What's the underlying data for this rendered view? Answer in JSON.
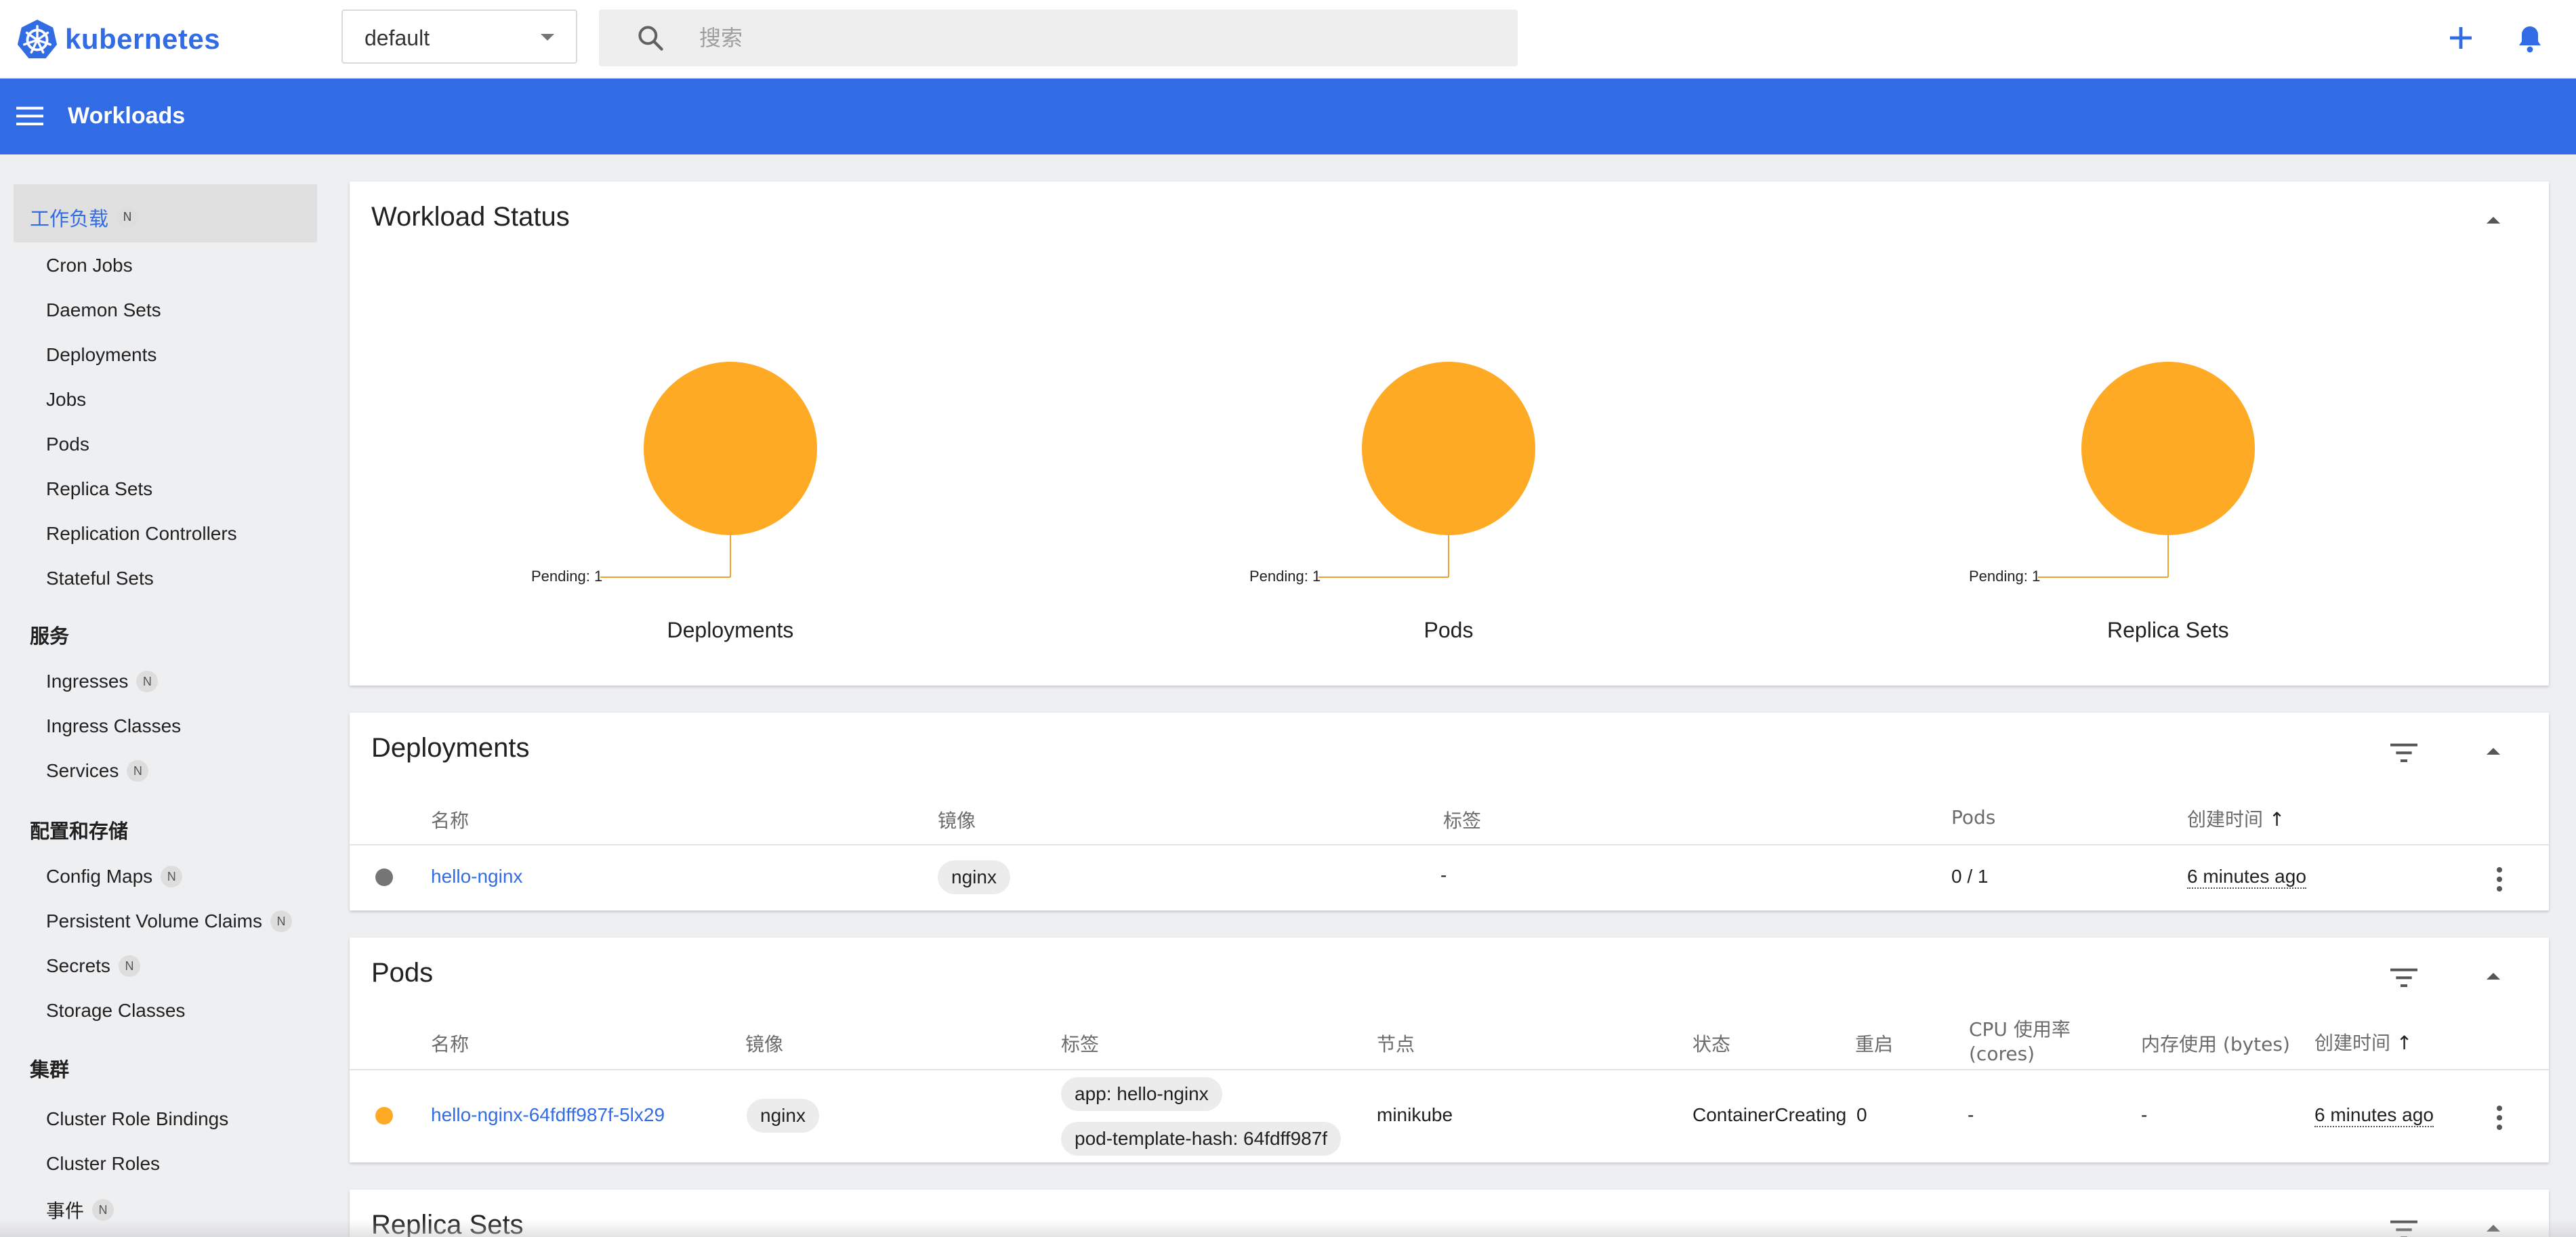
{
  "topbar": {
    "logo_text": "kubernetes",
    "namespace": "default",
    "search_placeholder": "搜索"
  },
  "bluebar": {
    "title": "Workloads"
  },
  "sidebar": {
    "groups": [
      {
        "label": "工作负载",
        "badge": "N",
        "items": [
          "Cron Jobs",
          "Daemon Sets",
          "Deployments",
          "Jobs",
          "Pods",
          "Replica Sets",
          "Replication Controllers",
          "Stateful Sets"
        ]
      },
      {
        "label": "服务",
        "items": [
          {
            "label": "Ingresses",
            "badge": "N"
          },
          {
            "label": "Ingress Classes"
          },
          {
            "label": "Services",
            "badge": "N"
          }
        ]
      },
      {
        "label": "配置和存储",
        "items": [
          {
            "label": "Config Maps",
            "badge": "N"
          },
          {
            "label": "Persistent Volume Claims",
            "badge": "N"
          },
          {
            "label": "Secrets",
            "badge": "N"
          },
          {
            "label": "Storage Classes"
          }
        ]
      },
      {
        "label": "集群",
        "items": [
          {
            "label": "Cluster Role Bindings"
          },
          {
            "label": "Cluster Roles"
          },
          {
            "label": "事件",
            "badge": "N"
          }
        ]
      }
    ]
  },
  "workload_status": {
    "title": "Workload Status",
    "charts": [
      {
        "caption": "Deployments",
        "legend": "Pending: 1",
        "pending": 1
      },
      {
        "caption": "Pods",
        "legend": "Pending: 1",
        "pending": 1
      },
      {
        "caption": "Replica Sets",
        "legend": "Pending: 1",
        "pending": 1
      }
    ],
    "pending_color": "#ffaa25"
  },
  "deployments": {
    "title": "Deployments",
    "headers": {
      "name": "名称",
      "image": "镜像",
      "labels": "标签",
      "pods": "Pods",
      "created": "创建时间"
    },
    "rows": [
      {
        "name": "hello-nginx",
        "image": "nginx",
        "labels": "-",
        "pods": "0 / 1",
        "created": "6 minutes ago",
        "status_color": "#757575"
      }
    ]
  },
  "pods": {
    "title": "Pods",
    "headers": {
      "name": "名称",
      "image": "镜像",
      "labels": "标签",
      "node": "节点",
      "status": "状态",
      "restarts": "重启",
      "cpu": "CPU 使用率 (cores)",
      "memory": "内存使用 (bytes)",
      "created": "创建时间"
    },
    "rows": [
      {
        "name": "hello-nginx-64fdff987f-5lx29",
        "image": "nginx",
        "label1": "app: hello-nginx",
        "label2": "pod-template-hash: 64fdff987f",
        "node": "minikube",
        "status": "ContainerCreating",
        "restarts": "0",
        "cpu": "-",
        "memory": "-",
        "created": "6 minutes ago",
        "status_color": "#ffaa25"
      }
    ]
  },
  "replica_sets": {
    "title": "Replica Sets"
  },
  "sort_arrow": "↑"
}
